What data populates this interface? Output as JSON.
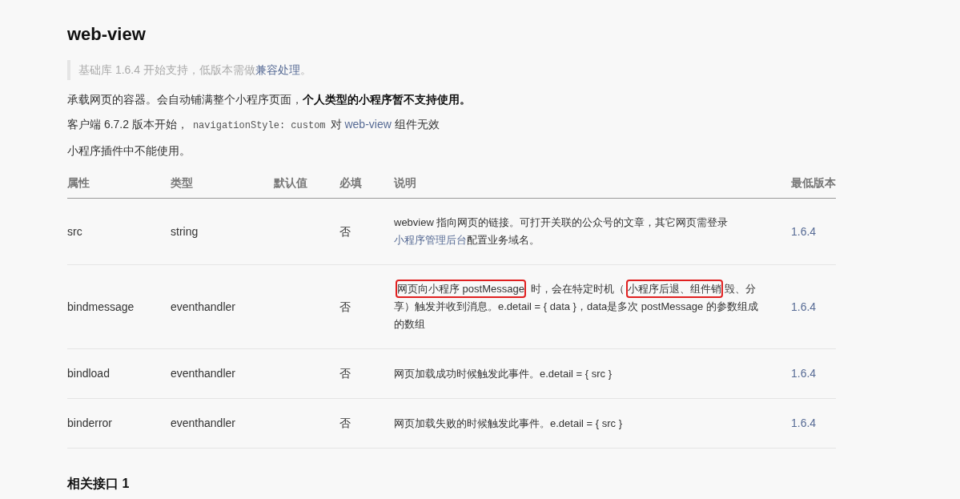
{
  "title": "web-view",
  "note": [
    {
      "kind": "text",
      "text": "基础库 1.6.4 开始支持，低版本需做"
    },
    {
      "kind": "link",
      "text": "兼容处理"
    },
    {
      "kind": "text",
      "text": "。"
    }
  ],
  "paragraphs": [
    [
      {
        "kind": "text",
        "text": "承载网页的容器。会自动铺满整个小程序页面，"
      },
      {
        "kind": "bold",
        "text": "个人类型的小程序暂不支持使用。"
      }
    ],
    [
      {
        "kind": "text",
        "text": "客户端 6.7.2 版本开始，"
      },
      {
        "kind": "code",
        "text": "navigationStyle: custom"
      },
      {
        "kind": "text",
        "text": "对 "
      },
      {
        "kind": "link",
        "text": "web-view"
      },
      {
        "kind": "text",
        "text": " 组件无效"
      }
    ],
    [
      {
        "kind": "text",
        "text": "小程序插件中不能使用。"
      }
    ]
  ],
  "table": {
    "columns": [
      "属性",
      "类型",
      "默认值",
      "必填",
      "说明",
      "最低版本"
    ],
    "rows": [
      {
        "name": "src",
        "type": "string",
        "required": "否",
        "description": [
          {
            "kind": "text",
            "text": "webview 指向网页的链接。可打开关联的公众号的文章，其它网页需登录"
          },
          {
            "kind": "link",
            "text": "小程序管理后台"
          },
          {
            "kind": "text",
            "text": "配置业务域名。"
          }
        ],
        "version": "1.6.4"
      },
      {
        "name": "bindmessage",
        "type": "eventhandler",
        "required": "否",
        "description": [
          {
            "kind": "highlight",
            "text": "网页向小程序 postMessage"
          },
          {
            "kind": "text",
            "text": " 时，会在特定时机（"
          },
          {
            "kind": "highlight",
            "text": "小程序后退、组件销"
          },
          {
            "kind": "text",
            "text": "毁、分享）触发并收到消息。e.detail = { data }，data是多次 postMessage 的参数组成的数组"
          }
        ],
        "version": "1.6.4"
      },
      {
        "name": "bindload",
        "type": "eventhandler",
        "required": "否",
        "description": [
          {
            "kind": "text",
            "text": "网页加载成功时候触发此事件。e.detail = { src }"
          }
        ],
        "version": "1.6.4"
      },
      {
        "name": "binderror",
        "type": "eventhandler",
        "required": "否",
        "description": [
          {
            "kind": "text",
            "text": "网页加载失败的时候触发此事件。e.detail = { src }"
          }
        ],
        "version": "1.6.4"
      }
    ]
  },
  "next_heading": "相关接口 1"
}
